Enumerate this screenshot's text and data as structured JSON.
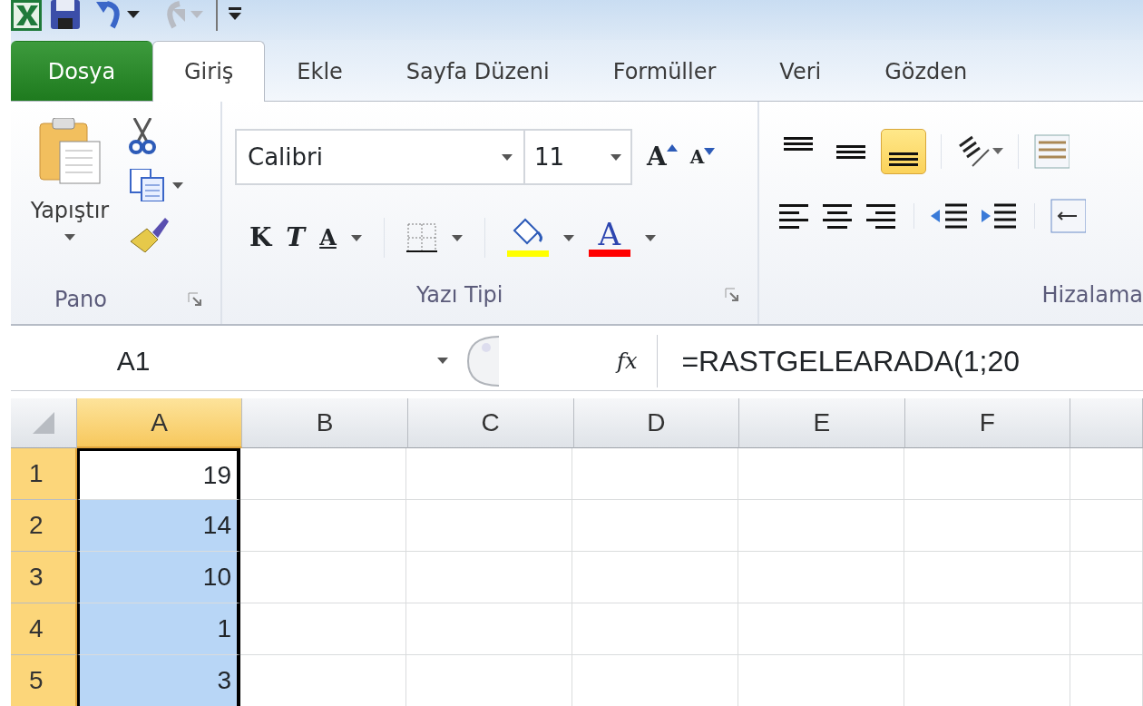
{
  "tabs": [
    {
      "label": "Dosya",
      "kind": "file",
      "selected": false
    },
    {
      "label": "Giriş",
      "kind": "tab",
      "selected": true
    },
    {
      "label": "Ekle",
      "kind": "tab",
      "selected": false
    },
    {
      "label": "Sayfa Düzeni",
      "kind": "tab",
      "selected": false
    },
    {
      "label": "Formüller",
      "kind": "tab",
      "selected": false
    },
    {
      "label": "Veri",
      "kind": "tab",
      "selected": false
    },
    {
      "label": "Gözden",
      "kind": "tab",
      "selected": false
    }
  ],
  "clipboard": {
    "paste_label": "Yapıştır",
    "label": "Pano"
  },
  "font": {
    "font_name": "Calibri",
    "font_size": "11",
    "grow": "A",
    "shrink": "A",
    "bold": "K",
    "italic": "T",
    "underline": "A",
    "font_color": "A",
    "label": "Yazı Tipi"
  },
  "alignment": {
    "label": "Hizalama",
    "vertical": [
      {
        "kind": "top",
        "selected": false
      },
      {
        "kind": "middle",
        "selected": false
      },
      {
        "kind": "bottom",
        "selected": true
      }
    ]
  },
  "formula_bar": {
    "name_box": "A1",
    "function_label": "fx",
    "formula": "=RASTGELEARADA(1;20"
  },
  "grid": {
    "columns": [
      {
        "label": "A",
        "selected": true
      },
      {
        "label": "B",
        "selected": false
      },
      {
        "label": "C",
        "selected": false
      },
      {
        "label": "D",
        "selected": false
      },
      {
        "label": "E",
        "selected": false
      },
      {
        "label": "F",
        "selected": false
      }
    ],
    "rows": [
      {
        "label": "1",
        "value": "19",
        "selected": true,
        "active": true
      },
      {
        "label": "2",
        "value": "14",
        "selected": true,
        "active": false
      },
      {
        "label": "3",
        "value": "10",
        "selected": true,
        "active": false
      },
      {
        "label": "4",
        "value": "1",
        "selected": true,
        "active": false
      },
      {
        "label": "5",
        "value": "3",
        "selected": true,
        "active": false
      }
    ]
  }
}
